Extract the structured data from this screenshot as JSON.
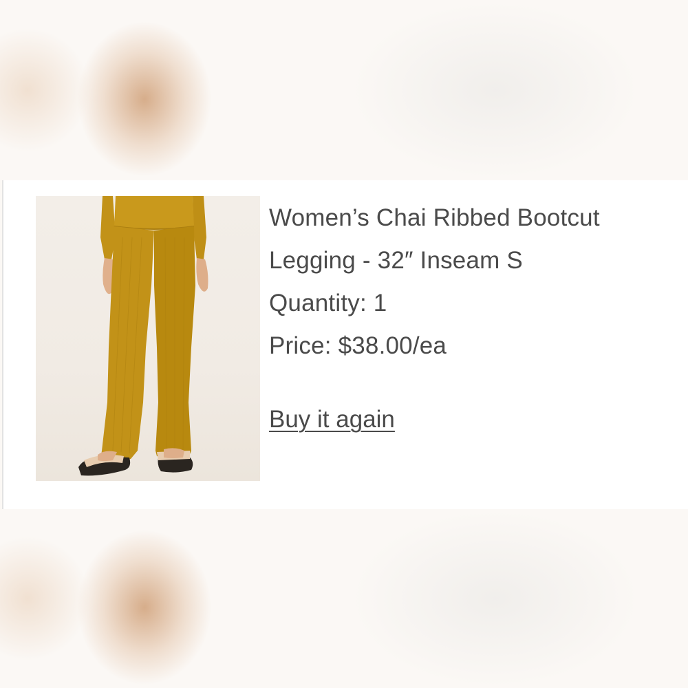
{
  "product": {
    "title_line1": "Women’s Chai Ribbed Bootcut",
    "title_line2": "Legging - 32″ Inseam S",
    "quantity": "Quantity: 1",
    "price": "Price: $38.00/ea",
    "buy_again_label": "Buy it again",
    "image_icon": "product-photo-mustard-legging",
    "garment_color": "#c29218"
  }
}
